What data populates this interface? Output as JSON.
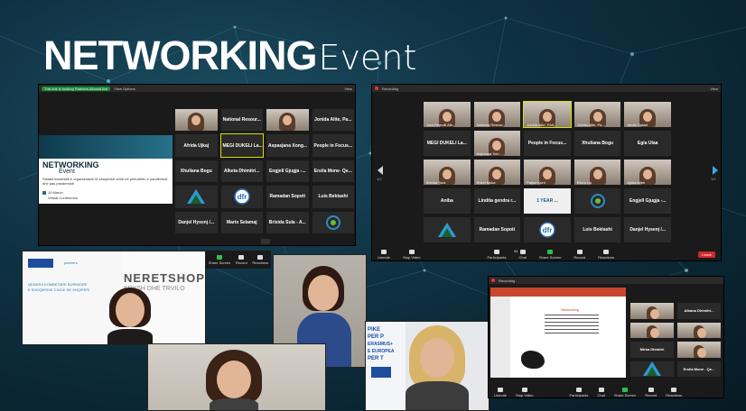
{
  "event_title": {
    "strong": "NETWORKING",
    "light": "Event"
  },
  "left_window": {
    "banner": "This link is hosting Partners Albania live",
    "view_options": "View Options",
    "view": "View",
    "slide": {
      "title_strong": "NETWORKING",
      "title_light": "Event",
      "subtitle": "Sfidat/mundësitë e organizatave të shoqërisë civile në periudhën e pandemisë dhe pas pandemisë",
      "date": "10 March",
      "format": "Virtual Conference"
    },
    "tiles": [
      "National Resour...",
      "Jonida Alite, Pa...",
      "Afrida Ujkaj",
      "MEGI DUKELI La...",
      "Aspasjana Xong...",
      "People in Focus...",
      "Xhuliana Bogu",
      "Alketa Dhimitri...",
      "Engjell Gjugja -...",
      "Ersila Mone- Qe...",
      "Partners Albania",
      "Observatori per...",
      "Ramadan Sopoti",
      "Luis Bektashi",
      "Danjel Hysenj /...",
      "Mario Selamaj",
      "Brixida Sula - A...",
      "Resource Centre"
    ],
    "toolbar": [
      "Share Screen",
      "Record",
      "Reactions"
    ]
  },
  "right_window": {
    "recording": "Recording",
    "view": "View",
    "page_left": "1/2",
    "page_right": "1/2",
    "tiles": [
      "Jora Demolli Alb...",
      "National Resour...",
      "Jonida Alite, Part...",
      "Jonida Alite, Pa...",
      "Ariola Galani",
      "MEGI DUKELI La...",
      "Anjezana Xon...",
      "People in Focus...",
      "Xhuliana Bogu",
      "Egla Ulaa",
      "Brixida Sula",
      "Enkel Muka",
      "Fatjon Kurti",
      "Elvira Llo",
      "Ajsha Alibe",
      "Aniba",
      "Lindita gendra r...",
      "1 YEAR ...",
      "Resource Centre",
      "Engjell Gjugja -...",
      "Partners Albania",
      "Ramadan Sopoti",
      "Observatori per...",
      "Luis Bektashi",
      "Danjel Hysenj /..."
    ],
    "toolbar": [
      "Unmute",
      "Stop Video",
      "Participants",
      "Chat",
      "Share Screen",
      "Record",
      "Reactions"
    ],
    "participants_count": "41",
    "leave": "Leave"
  },
  "bottom_right_window": {
    "recording": "Recording",
    "slide_title": "Networking",
    "tiles": [
      "",
      "Albana Dhimitri...",
      "",
      "",
      "Mirka Dhimitri",
      "",
      "Partners Albania",
      "Ersila Mone - Qe..."
    ],
    "toolbar": [
      "Unmute",
      "Stop Video",
      "Participants",
      "Chat",
      "Share Screen",
      "Record",
      "Reactions"
    ]
  },
  "video_collage": {
    "banner_left_line1": "QENDRA KOMBETARE BURIMORE",
    "banner_left_line2": "E SHOQERISE CIVILE NE SHQIPERI",
    "banner_right_line1": "NERETSHOPE",
    "banner_right_line2": "KRYSH DHE TRVILO",
    "tool_labels": [
      "Share Screen",
      "Record",
      "Reactions"
    ],
    "poster_lines": [
      "PIKE",
      "PER P",
      "ERASMUS+",
      "E EUROPEA",
      "PER T"
    ]
  }
}
